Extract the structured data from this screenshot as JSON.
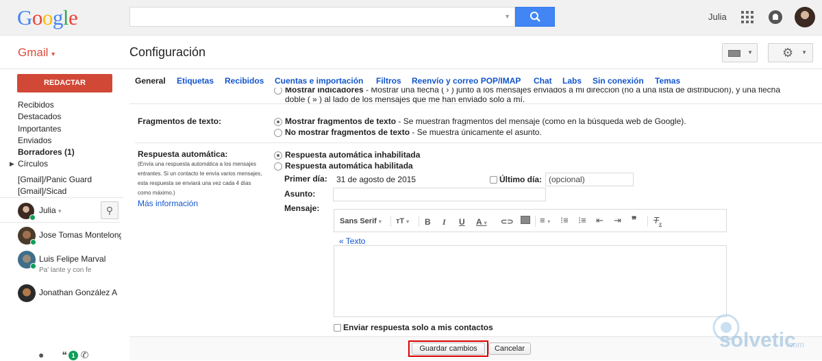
{
  "header": {
    "logo": "Google",
    "user_name": "Julia",
    "app": "Gmail",
    "page_title": "Configuración"
  },
  "sidebar": {
    "compose": "REDACTAR",
    "items": [
      {
        "label": "Recibidos"
      },
      {
        "label": "Destacados"
      },
      {
        "label": "Importantes"
      },
      {
        "label": "Enviados"
      },
      {
        "label": "Borradores (1)"
      },
      {
        "label": "Círculos"
      },
      {
        "label": "[Gmail]/Panic Guard"
      },
      {
        "label": "[Gmail]/Sicad"
      }
    ],
    "chat_me": "Julia",
    "contacts": [
      {
        "name": "Jose Tomas Montelongo",
        "status": ""
      },
      {
        "name": "Luis Felipe Marval",
        "status": "Pa' lante y con fe"
      },
      {
        "name": "Jonathan González A",
        "status": ""
      }
    ],
    "badge": "1"
  },
  "tabs": [
    "General",
    "Etiquetas",
    "Recibidos",
    "Cuentas e importación",
    "Filtros",
    "Reenvío y correo POP/IMAP",
    "Chat",
    "Labs",
    "Sin conexión",
    "Temas"
  ],
  "indicators": {
    "line1_bold": "Mostrar indicadores",
    "line1_rest": " - Mostrar una flecha ( › ) junto a los mensajes enviados a mi dirección (no a una lista de distribución), y una flecha",
    "line2": "doble ( » ) al lado de los mensajes que me han enviado solo a mí."
  },
  "snippets": {
    "label": "Fragmentos de texto:",
    "opt1_bold": "Mostrar fragmentos de texto",
    "opt1_rest": " - Se muestran fragmentos del mensaje (como en la búsqueda web de Google).",
    "opt2_bold": "No mostrar fragmentos de texto",
    "opt2_rest": " - Se muestra únicamente el asunto."
  },
  "autoreply": {
    "label": "Respuesta automática:",
    "help": "(Envía una respuesta automática a los mensajes entrantes. Si un contacto te envía varios mensajes, esta respuesta se enviará una vez cada 4 días como máximo.)",
    "more_info": "Más información",
    "opt_off": "Respuesta automática inhabilitada",
    "opt_on": "Respuesta automática habilitada",
    "first_day_label": "Primer día:",
    "first_day_value": "31 de agosto de 2015",
    "last_day_label": "Último día:",
    "last_day_placeholder": "(opcional)",
    "subject_label": "Asunto:",
    "message_label": "Mensaje:",
    "font_name": "Sans Serif",
    "quote_link": "« Texto",
    "contacts_only": "Enviar respuesta solo a mis contactos"
  },
  "footer": {
    "save": "Guardar cambios",
    "cancel": "Cancelar"
  },
  "watermark": {
    "brand": "solvetic",
    "suffix": ".com"
  }
}
